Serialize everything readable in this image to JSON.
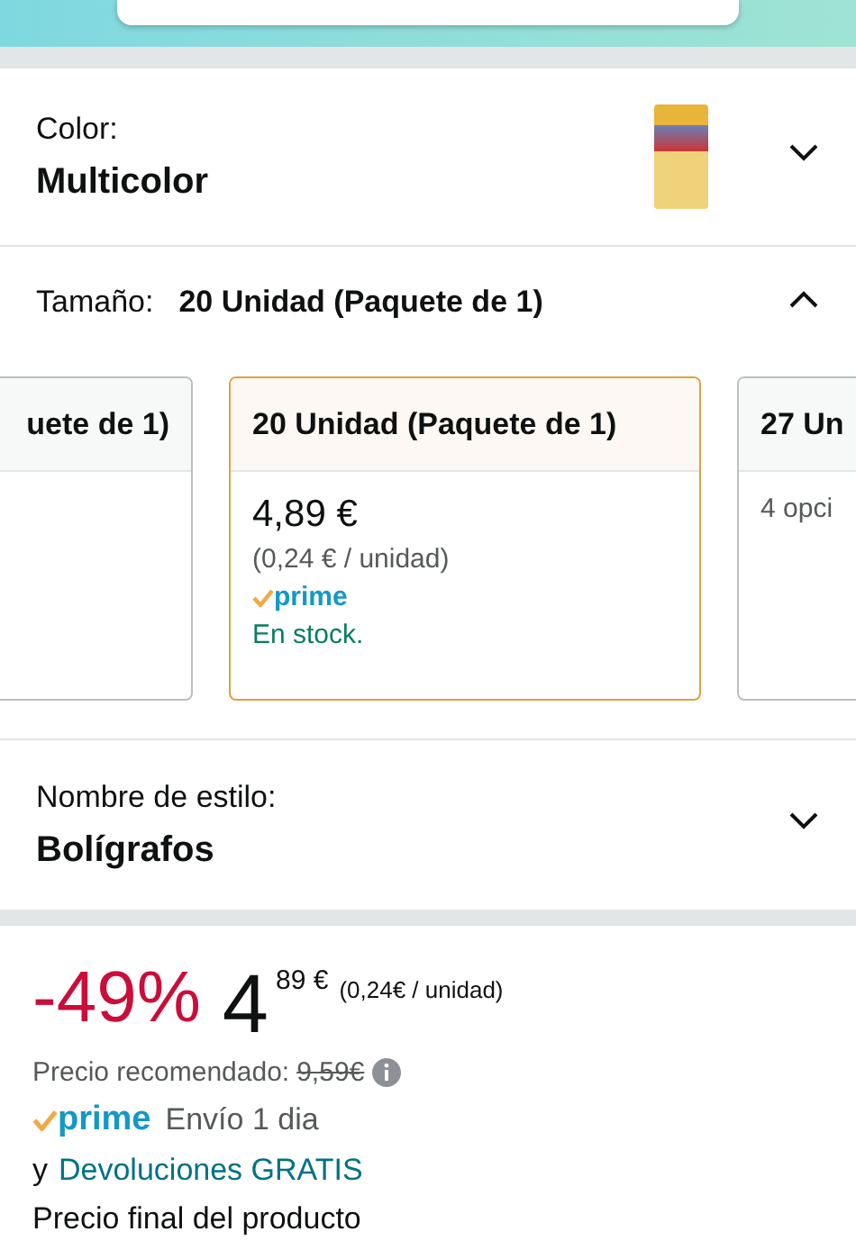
{
  "color_option": {
    "label": "Color:",
    "value": "Multicolor",
    "expanded": false
  },
  "size_option": {
    "label": "Tamaño:",
    "value": "20 Unidad (Paquete de 1)",
    "expanded": true,
    "cards": [
      {
        "title": "uete de 1)",
        "selected": false
      },
      {
        "title": "20 Unidad (Paquete de 1)",
        "selected": true,
        "price": "4,89 €",
        "unit_price": "(0,24 € / unidad)",
        "prime": "prime",
        "stock": "En stock."
      },
      {
        "title": "27 Un",
        "selected": false,
        "options": "4 opci"
      }
    ]
  },
  "style_option": {
    "label": "Nombre de estilo:",
    "value": "Bolígrafos",
    "expanded": false
  },
  "price": {
    "discount": "-49%",
    "whole": "4",
    "fraction": "89 €",
    "unit_price": "(0,24€ / unidad)",
    "list_label": "Precio recomendado:",
    "list_price": "9,59€"
  },
  "delivery": {
    "prime": "prime",
    "shipping": "Envío 1 dia",
    "prefix": "y",
    "returns_link": "Devoluciones GRATIS",
    "final_note": "Precio final del producto"
  }
}
